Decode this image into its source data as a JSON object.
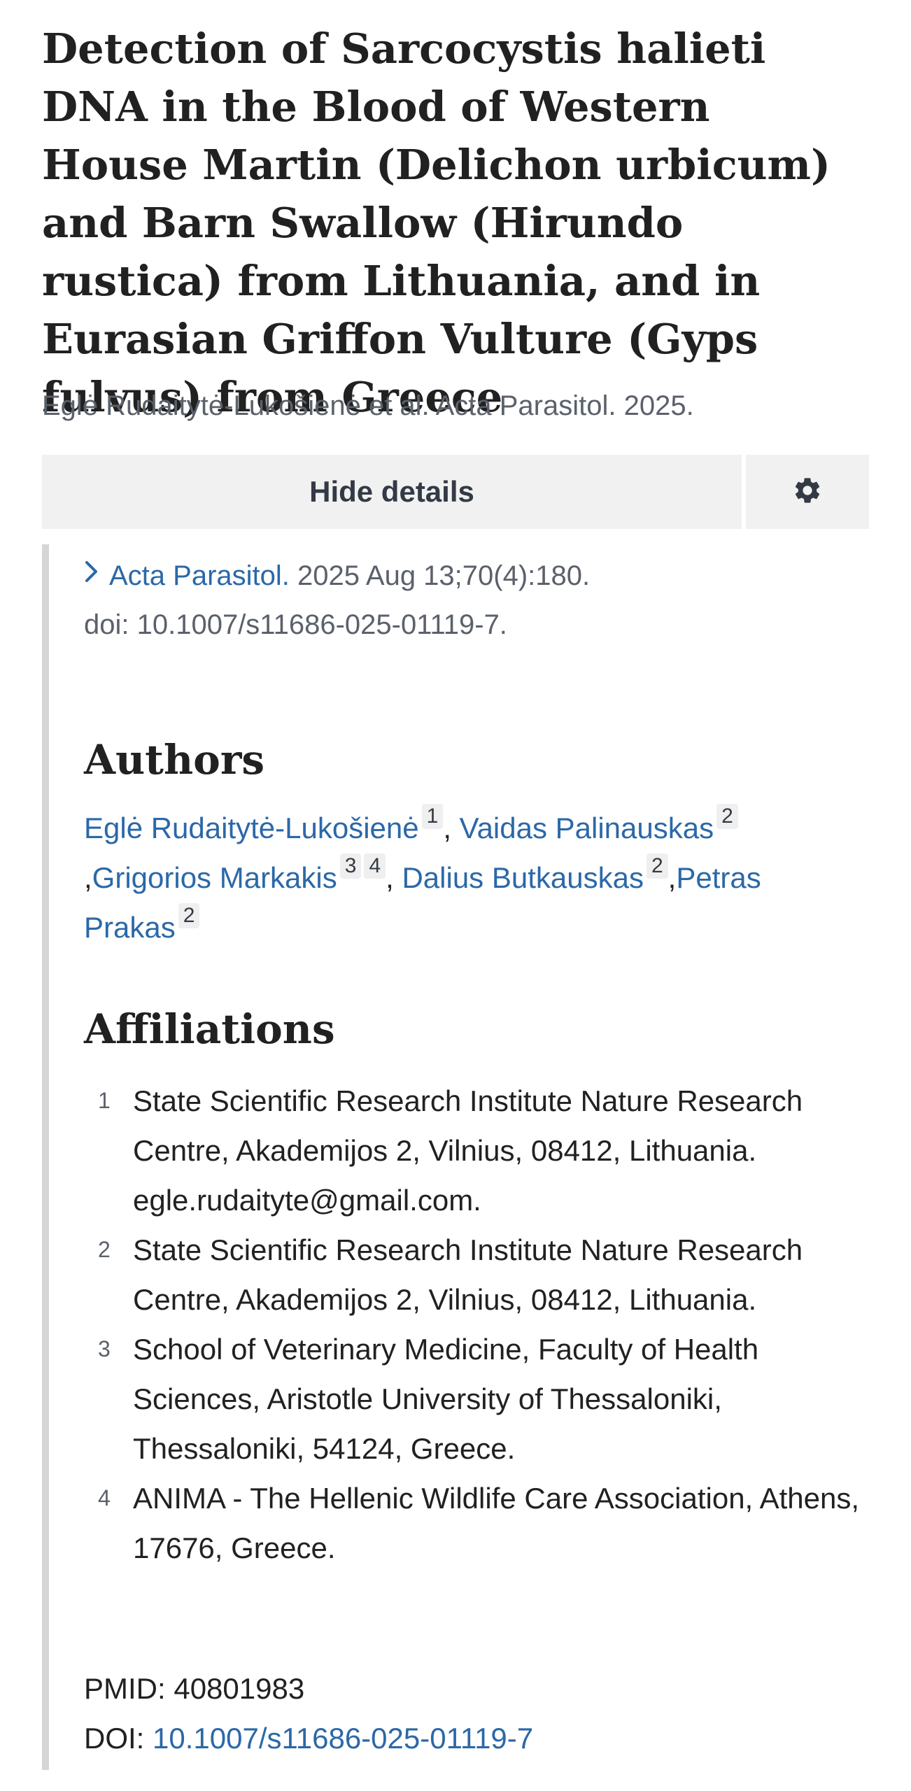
{
  "article": {
    "title": "Detection of Sarcocystis halieti DNA in the Blood of Western House Martin (Delichon urbicum) and Barn Swallow (Hirundo rustica) from Lithuania, and in Eurasian Griffon Vulture (Gyps fulvus) from Greece",
    "citation_short": "Eglė Rudaitytė-Lukošienė et al. Acta Parasitol. 2025."
  },
  "toolbar": {
    "hide_details_label": "Hide details",
    "settings_icon": "gear-icon"
  },
  "details": {
    "journal_icon": "chevron-right-icon",
    "journal": "Acta Parasitol.",
    "pub_info": " 2025 Aug 13;70(4):180.",
    "doi_line": "doi: 10.1007/s11686-025-01119-7."
  },
  "authors": {
    "heading": "Authors",
    "list": [
      {
        "name": "Eglė Rudaitytė-Lukošienė",
        "affs": [
          "1"
        ],
        "sep": ", "
      },
      {
        "name": "Vaidas Palinauskas",
        "affs": [
          "2"
        ],
        "sep": ","
      },
      {
        "name": "Grigorios Markakis",
        "affs": [
          "3",
          "4"
        ],
        "sep": ", "
      },
      {
        "name": "Dalius Butkauskas",
        "affs": [
          "2"
        ],
        "sep": ","
      },
      {
        "name": "Petras Prakas",
        "affs": [
          "2"
        ],
        "sep": ""
      }
    ]
  },
  "affiliations": {
    "heading": "Affiliations",
    "items": [
      {
        "num": "1",
        "text": "State Scientific Research Institute Nature Research Centre, Akademijos 2, Vilnius, 08412, Lithuania. egle.rudaityte@gmail.com."
      },
      {
        "num": "2",
        "text": "State Scientific Research Institute Nature Research Centre, Akademijos 2, Vilnius, 08412, Lithuania."
      },
      {
        "num": "3",
        "text": "School of Veterinary Medicine, Faculty of Health Sciences, Aristotle University of Thessaloniki, Thessaloniki, 54124, Greece."
      },
      {
        "num": "4",
        "text": "ANIMA - The Hellenic Wildlife Care Association, Athens, 17676, Greece."
      }
    ]
  },
  "identifiers": {
    "pmid_label": "PMID: ",
    "pmid": "40801983",
    "doi_label": "DOI: ",
    "doi": "10.1007/s11686-025-01119-7"
  },
  "colors": {
    "link": "#2b68a8",
    "button_bg": "#f1f1f1",
    "muted_text": "#5b616b"
  }
}
